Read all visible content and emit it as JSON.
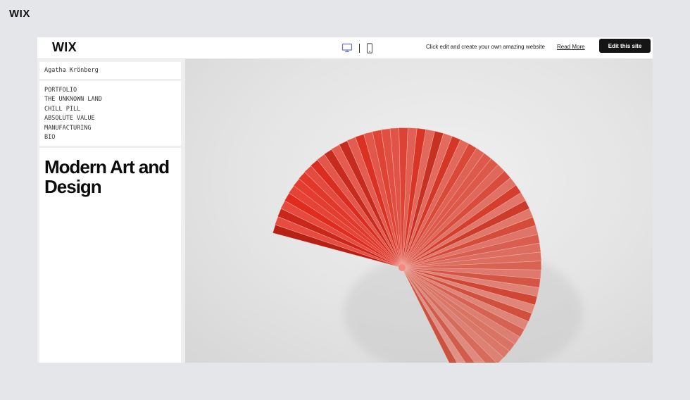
{
  "brand": {
    "outer_logo": "WIX",
    "editor_logo": "WIX"
  },
  "topbar": {
    "desktop_view_icon": "desktop-icon",
    "mobile_view_icon": "mobile-icon",
    "promo_text": "Click edit and create your own amazing website",
    "read_more_label": "Read More",
    "edit_button_label": "Edit this site"
  },
  "site": {
    "owner_name": "Agatha Krönberg",
    "nav_items": [
      "PORTFOLIO",
      "THE UNKNOWN LAND",
      "CHILL PILL",
      "ABSOLUTE VALUE",
      "MANUFACTURING",
      "BIO"
    ],
    "headline": "Modern Art and Design",
    "hero_image": "red-paper-fan-artwork"
  },
  "colors": {
    "page_background": "#e5e6e9",
    "accent_purple": "#6b6fd6",
    "button_dark": "#151515",
    "fan_red": "#e8493f"
  }
}
